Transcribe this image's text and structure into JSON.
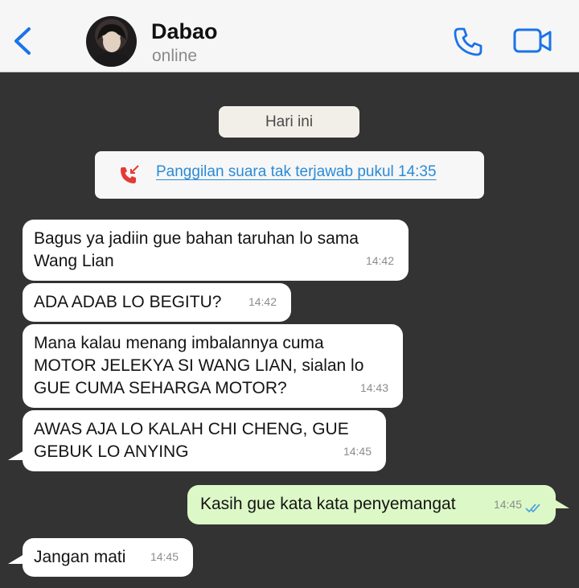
{
  "header": {
    "contact_name": "Dabao",
    "status": "online"
  },
  "colors": {
    "accent": "#1a73e8",
    "chat_background": "#333333",
    "incoming_bubble": "#ffffff",
    "outgoing_bubble": "#dcf8c6",
    "missed_call_link": "#2a8bd8",
    "missed_call_icon": "#e53935"
  },
  "icons": {
    "back": "chevron-left-icon",
    "call": "phone-icon",
    "video": "video-camera-icon",
    "missed_call": "missed-call-icon",
    "read_receipt": "double-check-icon"
  },
  "chat": {
    "date_label": "Hari ini",
    "missed_call_text": "Panggilan suara tak terjawab pukul 14:35",
    "messages": [
      {
        "direction": "in",
        "lines": [
          "Bagus ya jadiin gue bahan taruhan lo sama",
          "Wang Lian"
        ],
        "time": "14:42"
      },
      {
        "direction": "in",
        "lines": [
          "ADA ADAB LO BEGITU?"
        ],
        "time": "14:42"
      },
      {
        "direction": "in",
        "lines": [
          "Mana kalau menang imbalannya cuma",
          "MOTOR JELEKYA SI WANG LIAN, sialan lo",
          "GUE CUMA SEHARGA MOTOR?"
        ],
        "time": "14:43"
      },
      {
        "direction": "in",
        "lines": [
          "AWAS AJA LO KALAH CHI CHENG, GUE",
          "GEBUK LO ANYING"
        ],
        "time": "14:45"
      },
      {
        "direction": "out",
        "lines": [
          "Kasih gue kata kata penyemangat"
        ],
        "time": "14:45",
        "read": true
      },
      {
        "direction": "in",
        "lines": [
          "Jangan mati"
        ],
        "time": "14:45"
      }
    ]
  }
}
